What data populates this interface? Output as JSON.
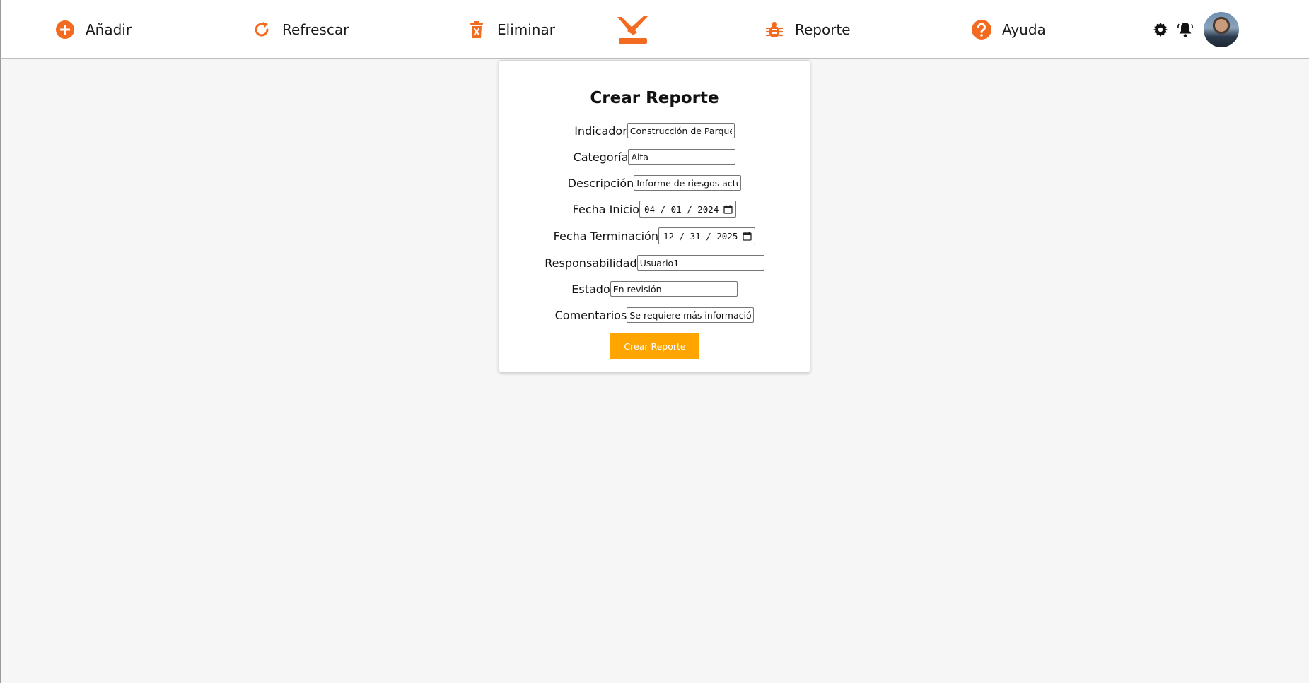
{
  "colors": {
    "accent": "#f26b21",
    "button_bg": "#ffa500",
    "page_bg": "#f6f6f6"
  },
  "nav": {
    "add": {
      "label": "Añadir",
      "icon": "plus-circle-icon"
    },
    "refresh": {
      "label": "Refrescar",
      "icon": "refresh-icon"
    },
    "delete": {
      "label": "Eliminar",
      "icon": "trash-icon"
    },
    "report": {
      "label": "Reporte",
      "icon": "bug-icon"
    },
    "help": {
      "label": "Ayuda",
      "icon": "question-circle-icon"
    }
  },
  "logo": {
    "icon": "brand-logo-icon"
  },
  "toolbar_right": {
    "settings_icon": "gear-icon",
    "notifications_icon": "bell-icon",
    "avatar": "user-avatar"
  },
  "form": {
    "title": "Crear Reporte",
    "fields": {
      "indicador": {
        "label": "Indicador",
        "value": "Construcción de Parques Ter"
      },
      "categoria": {
        "label": "Categoría",
        "value": "Alta"
      },
      "descripcion": {
        "label": "Descripción",
        "value": "Informe de riesgos actualiza"
      },
      "fecha_inicio": {
        "label": "Fecha Inicio",
        "value": "04 / 01 / 2024"
      },
      "fecha_terminacion": {
        "label": "Fecha Terminación",
        "value": "12 / 31 / 2025"
      },
      "responsabilidad": {
        "label": "Responsabilidad",
        "value": "Usuario1"
      },
      "estado": {
        "label": "Estado",
        "value": "En revisión"
      },
      "comentarios": {
        "label": "Comentarios",
        "value": "Se requiere más información"
      }
    },
    "submit_label": "Crear Reporte"
  }
}
